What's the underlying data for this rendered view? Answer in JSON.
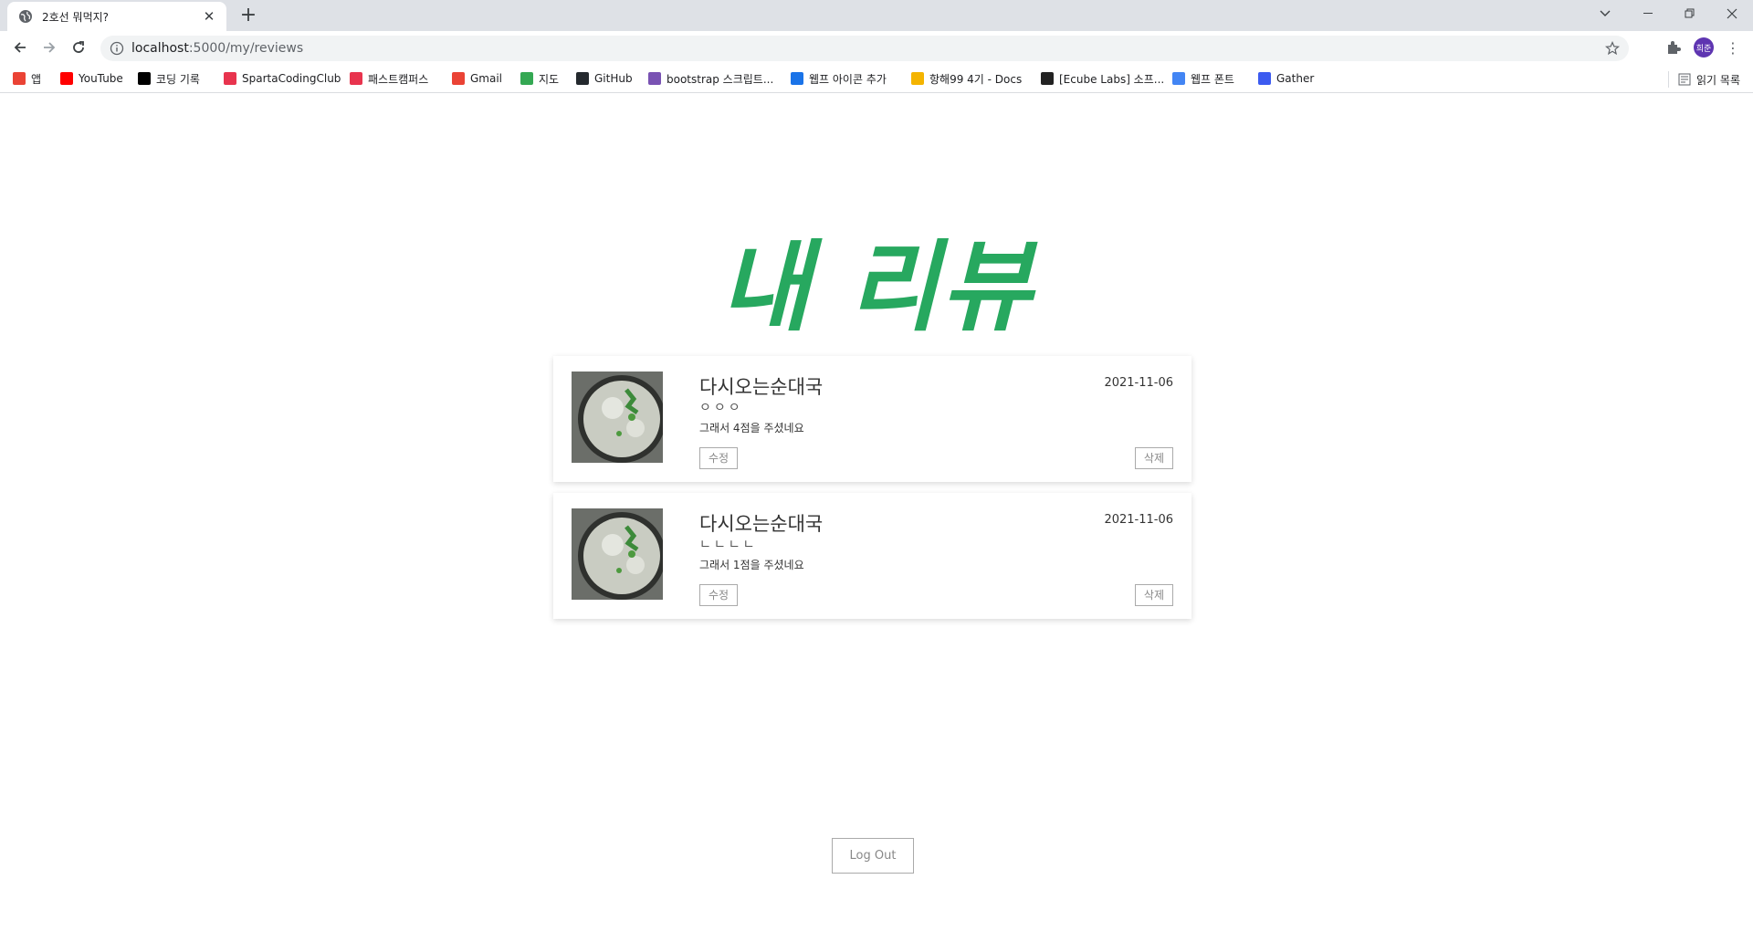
{
  "browser": {
    "tab_title": "2호선 뭐먹지?",
    "url_host": "localhost",
    "url_rest": ":5000/my/reviews",
    "bookmarks": [
      {
        "label": "앱",
        "icon": "apps-icon",
        "color": "#ea4335"
      },
      {
        "label": "YouTube",
        "icon": "youtube-icon",
        "color": "#ff0000"
      },
      {
        "label": "코딩 기록",
        "icon": "medium-icon",
        "color": "#000000"
      },
      {
        "label": "SpartaCodingClub",
        "icon": "sparta-icon",
        "color": "#e8344e"
      },
      {
        "label": "패스트캠퍼스",
        "icon": "fastcampus-icon",
        "color": "#e8344e"
      },
      {
        "label": "Gmail",
        "icon": "gmail-icon",
        "color": "#ea4335"
      },
      {
        "label": "지도",
        "icon": "maps-icon",
        "color": "#34a853"
      },
      {
        "label": "GitHub",
        "icon": "github-icon",
        "color": "#24292e"
      },
      {
        "label": "bootstrap 스크립트...",
        "icon": "bootstrap-icon",
        "color": "#7952b3"
      },
      {
        "label": "웹프 아이콘 추가",
        "icon": "flag-icon",
        "color": "#1a73e8"
      },
      {
        "label": "항해99 4기 - Docs",
        "icon": "docs-icon",
        "color": "#f4b400"
      },
      {
        "label": "[Ecube Labs] 소프...",
        "icon": "ecube-icon",
        "color": "#222222"
      },
      {
        "label": "웹프 폰트",
        "icon": "fonts-icon",
        "color": "#4285f4"
      },
      {
        "label": "Gather",
        "icon": "gather-icon",
        "color": "#3c5bf0"
      }
    ],
    "reading_list": "읽기 목록",
    "avatar_text": "희준"
  },
  "page": {
    "title": "내 리뷰",
    "accent": "#27a85f",
    "reviews": [
      {
        "store": "다시오는순대국",
        "comment": "ㅇㅇㅇ",
        "score_text": "그래서 4점을 주셨네요",
        "date": "2021-11-06",
        "edit": "수정",
        "delete": "삭제"
      },
      {
        "store": "다시오는순대국",
        "comment": "ㄴㄴㄴㄴ",
        "score_text": "그래서 1점을 주셨네요",
        "date": "2021-11-06",
        "edit": "수정",
        "delete": "삭제"
      }
    ],
    "logout": "Log Out"
  }
}
